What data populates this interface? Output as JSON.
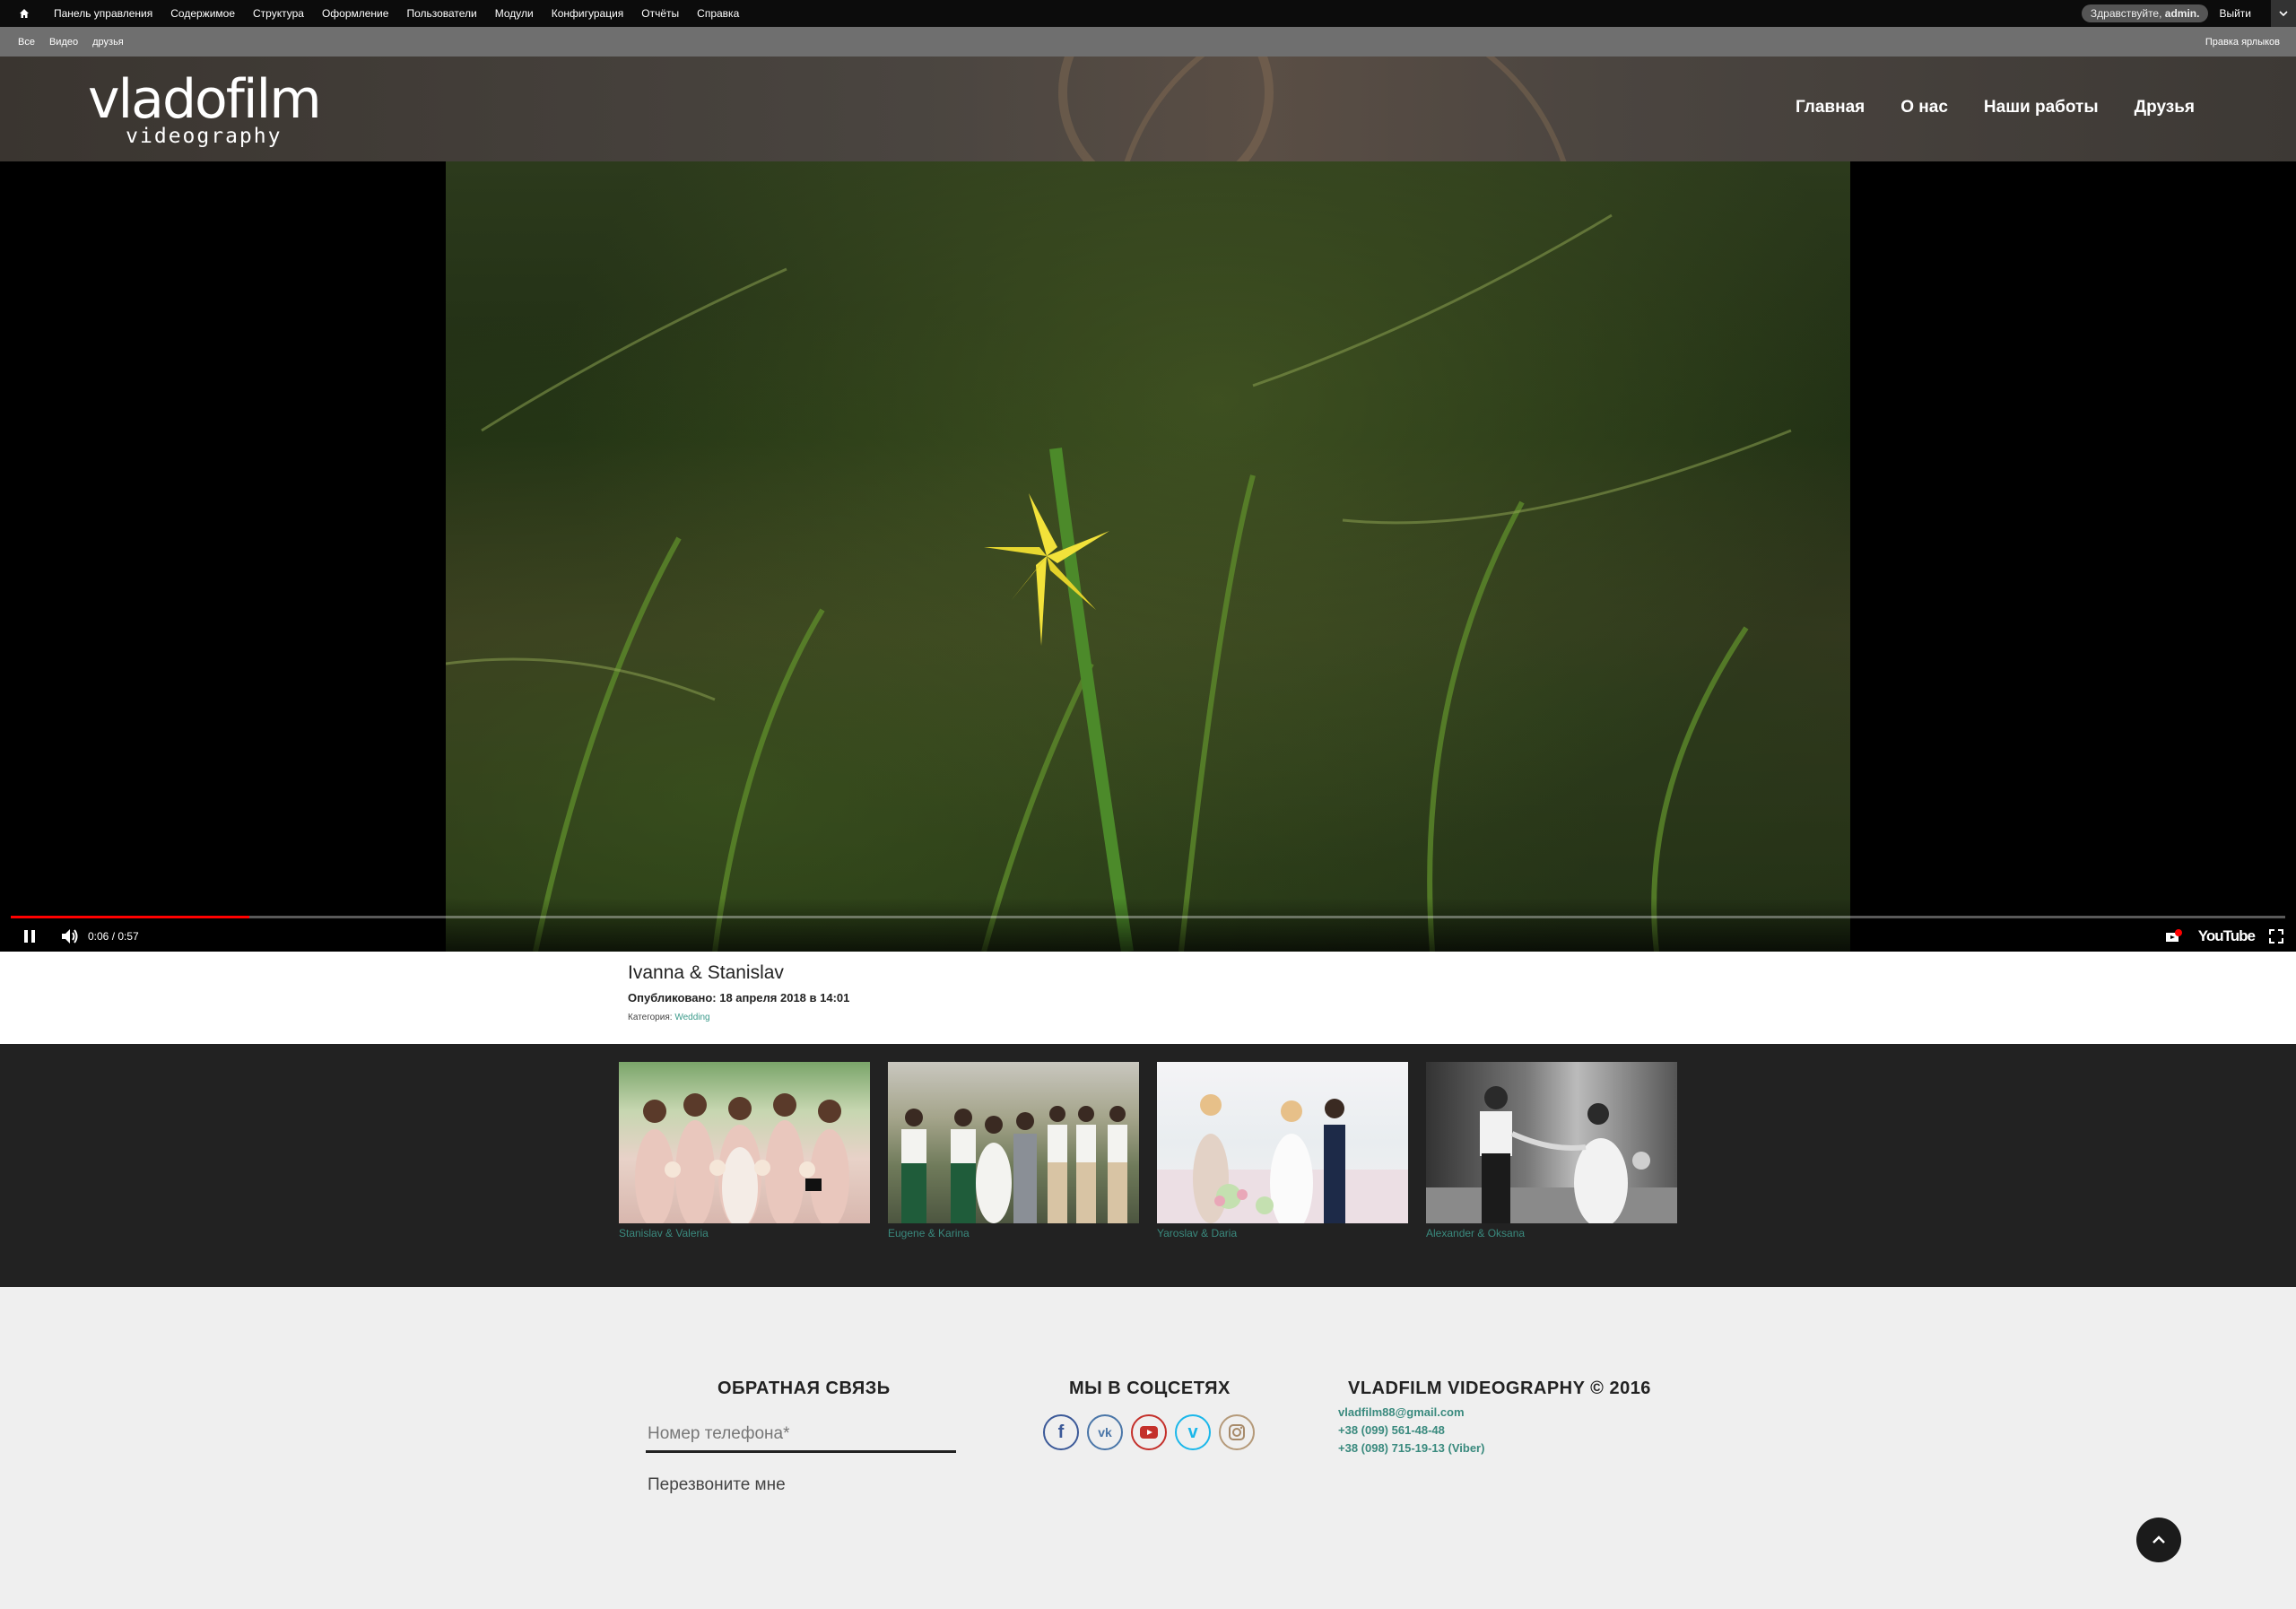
{
  "admin_bar": {
    "menu": [
      "Панель управления",
      "Содержимое",
      "Структура",
      "Оформление",
      "Пользователи",
      "Модули",
      "Конфигурация",
      "Отчёты",
      "Справка"
    ],
    "greeting_prefix": "Здравствуйте,",
    "greeting_user": "admin.",
    "logout": "Выйти"
  },
  "shortcut_bar": {
    "items": [
      "Все",
      "Видео",
      "друзья"
    ],
    "edit_label": "Правка ярлыков"
  },
  "header": {
    "logo_name": "vladofilm",
    "logo_sub": "videography",
    "nav": [
      "Главная",
      "О нас",
      "Наши работы",
      "Друзья"
    ]
  },
  "video": {
    "time": "0:06 / 0:57",
    "progress": 0.105,
    "youtube_label": "YouTube"
  },
  "post": {
    "title": "Ivanna & Stanislav",
    "published": "Опубликовано: 18 апреля 2018 в 14:01",
    "category_label": "Категория:",
    "category": "Wedding"
  },
  "related": [
    {
      "caption": "Stanislav & Valeria"
    },
    {
      "caption": "Eugene & Karina"
    },
    {
      "caption": "Yaroslav & Daria"
    },
    {
      "caption": "Alexander & Oksana"
    }
  ],
  "footer": {
    "feedback_title": "ОБРАТНАЯ СВЯЗЬ",
    "phone_placeholder": "Номер телефона*",
    "callback": "Перезвоните мне",
    "social_title": "МЫ В СОЦСЕТЯХ",
    "brand_title": "VLADFILM VIDEOGRAPHY © 2016",
    "email": "vladfilm88@gmail.com",
    "phone1": "+38 (099) 561-48-48",
    "phone2": "+38 (098) 715-19-13 (Viber)"
  },
  "colors": {
    "accent": "#3a8a7e",
    "progress": "#ff0000"
  }
}
